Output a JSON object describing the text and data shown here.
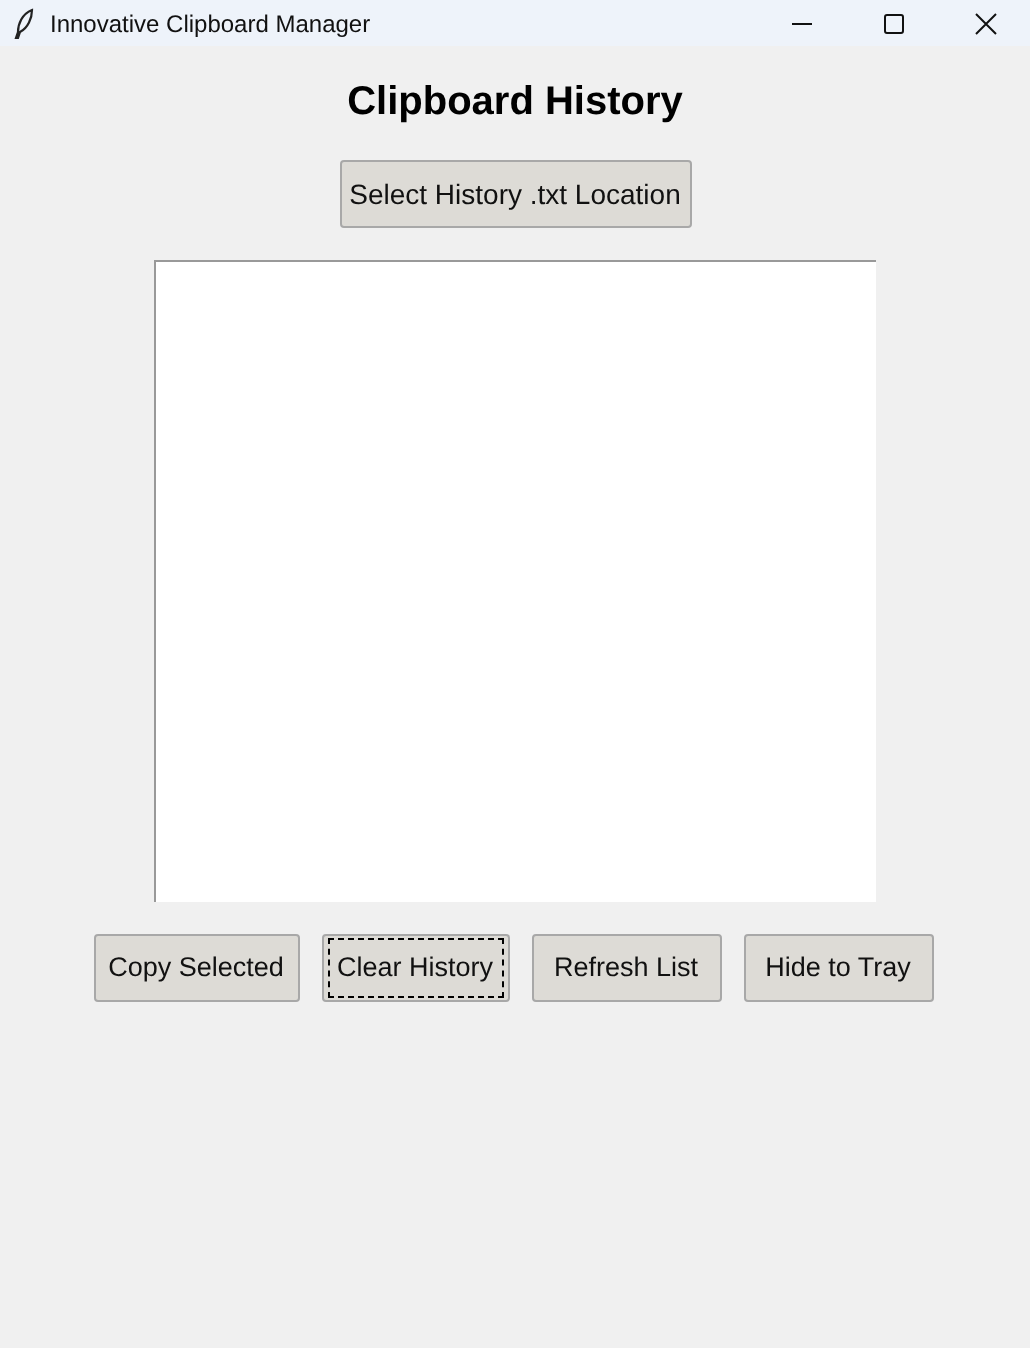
{
  "window": {
    "title": "Innovative Clipboard Manager"
  },
  "heading": "Clipboard History",
  "location_button": "Select History .txt Location",
  "buttons": [
    {
      "label": "Copy Selected",
      "focused": false
    },
    {
      "label": "Clear History",
      "focused": true
    },
    {
      "label": "Refresh List",
      "focused": false
    },
    {
      "label": "Hide to Tray",
      "focused": false
    }
  ]
}
